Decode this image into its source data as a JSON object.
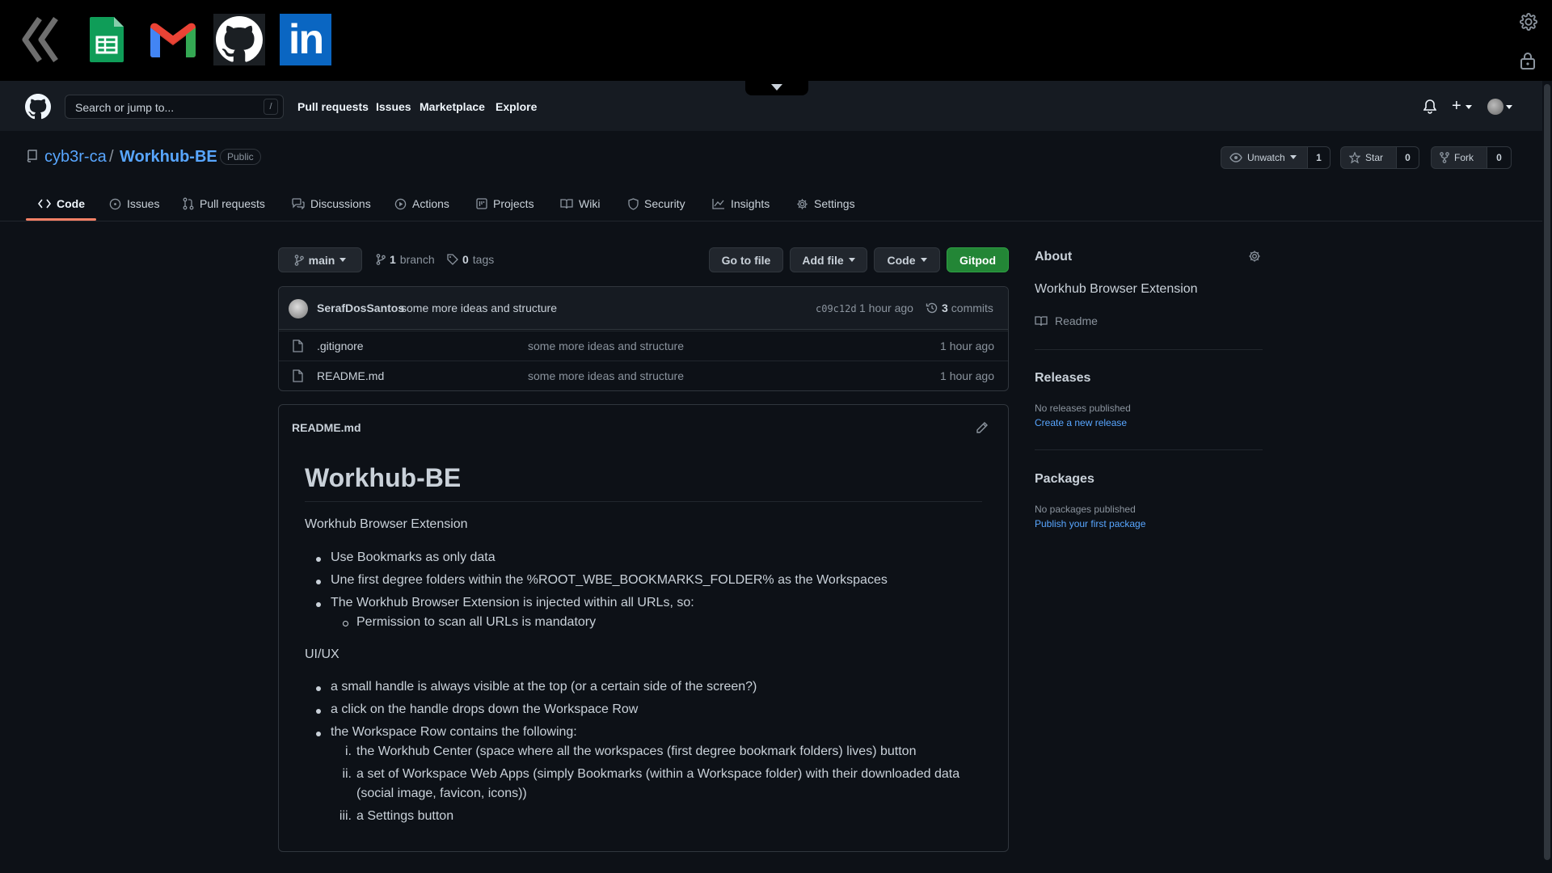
{
  "workspace_bar": {
    "apps": [
      {
        "name": "workhub-center",
        "icon": "double-chevron-left-icon"
      },
      {
        "name": "google-sheets",
        "icon": "sheets-icon"
      },
      {
        "name": "gmail",
        "icon": "gmail-icon"
      },
      {
        "name": "github",
        "icon": "github-icon"
      },
      {
        "name": "linkedin",
        "icon": "linkedin-icon",
        "label": "in"
      }
    ]
  },
  "header": {
    "search_placeholder": "Search or jump to...",
    "search_shortcut": "/",
    "nav": [
      "Pull requests",
      "Issues",
      "Marketplace",
      "Explore"
    ],
    "plus": "+"
  },
  "repo": {
    "owner": "cyb3r-ca",
    "separator": "/",
    "name": "Workhub-BE",
    "visibility": "Public",
    "watch_label": "Unwatch",
    "watch_count": "1",
    "star_label": "Star",
    "star_count": "0",
    "fork_label": "Fork",
    "fork_count": "0"
  },
  "tabs": [
    {
      "label": "Code",
      "icon": "code-icon",
      "active": true
    },
    {
      "label": "Issues",
      "icon": "issue-icon"
    },
    {
      "label": "Pull requests",
      "icon": "pull-request-icon"
    },
    {
      "label": "Discussions",
      "icon": "discussion-icon"
    },
    {
      "label": "Actions",
      "icon": "play-icon"
    },
    {
      "label": "Projects",
      "icon": "project-icon"
    },
    {
      "label": "Wiki",
      "icon": "book-icon"
    },
    {
      "label": "Security",
      "icon": "shield-icon"
    },
    {
      "label": "Insights",
      "icon": "graph-icon"
    },
    {
      "label": "Settings",
      "icon": "gear-icon"
    }
  ],
  "filenav": {
    "branch": "main",
    "branch_count": "1",
    "branch_label": "branch",
    "tag_count": "0",
    "tag_label": "tags",
    "go_to_file": "Go to file",
    "add_file": "Add file",
    "code": "Code",
    "gitpod": "Gitpod"
  },
  "commit": {
    "author": "SerafDosSantos",
    "message": "some more ideas and structure",
    "sha": "c09c12d",
    "time": "1 hour ago",
    "count": "3",
    "count_label": "commits"
  },
  "files": [
    {
      "name": ".gitignore",
      "message": "some more ideas and structure",
      "time": "1 hour ago"
    },
    {
      "name": "README.md",
      "message": "some more ideas and structure",
      "time": "1 hour ago"
    }
  ],
  "readme": {
    "filename": "README.md",
    "h1": "Workhub-BE",
    "intro": "Workhub Browser Extension",
    "list1": [
      "Use Bookmarks as only data",
      "Une first degree folders within the %ROOT_WBE_BOOKMARKS_FOLDER% as the Workspaces",
      "The Workhub Browser Extension is injected within all URLs, so:"
    ],
    "sublist1": [
      "Permission to scan all URLs is mandatory"
    ],
    "uiux": "UI/UX",
    "list2": [
      "a small handle is always visible at the top (or a certain side of the screen?)",
      "a click on the handle drops down the Workspace Row",
      "the Workspace Row contains the following:"
    ],
    "ordered": [
      {
        "num": "i.",
        "text": "the Workhub Center (space where all the workspaces (first degree bookmark folders) lives) button"
      },
      {
        "num": "ii.",
        "text": "a set of Workspace Web Apps (simply Bookmarks (within a Workspace folder) with their downloaded data",
        "text2": "(social image, favicon, icons))"
      },
      {
        "num": "iii.",
        "text": "a Settings button"
      }
    ]
  },
  "sidebar": {
    "about_title": "About",
    "description": "Workhub Browser Extension",
    "readme_link": "Readme",
    "releases_title": "Releases",
    "no_releases": "No releases published",
    "create_release": "Create a new release",
    "packages_title": "Packages",
    "no_packages": "No packages published",
    "publish_package": "Publish your first package"
  },
  "colors": {
    "accent": "#58a6ff",
    "gitpod": "#238636",
    "active_tab": "#f78166"
  }
}
